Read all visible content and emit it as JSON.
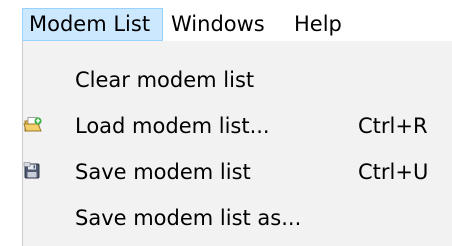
{
  "menubar": {
    "items": [
      {
        "label": "Modem List",
        "active": true
      },
      {
        "label": "Windows",
        "active": false
      },
      {
        "label": "Help",
        "active": false
      }
    ]
  },
  "dropdown": {
    "items": [
      {
        "label": "Clear modem list",
        "shortcut": "",
        "icon": ""
      },
      {
        "label": "Load modem list...",
        "shortcut": "Ctrl+R",
        "icon": "folder-open-icon"
      },
      {
        "label": "Save modem list",
        "shortcut": "Ctrl+U",
        "icon": "floppy-disk-icon"
      },
      {
        "label": "Save modem list as...",
        "shortcut": "",
        "icon": ""
      }
    ]
  },
  "colors": {
    "active_menu_bg": "#cce8ff",
    "active_menu_border": "#99d1ff",
    "dropdown_bg": "#f2f2f2"
  }
}
